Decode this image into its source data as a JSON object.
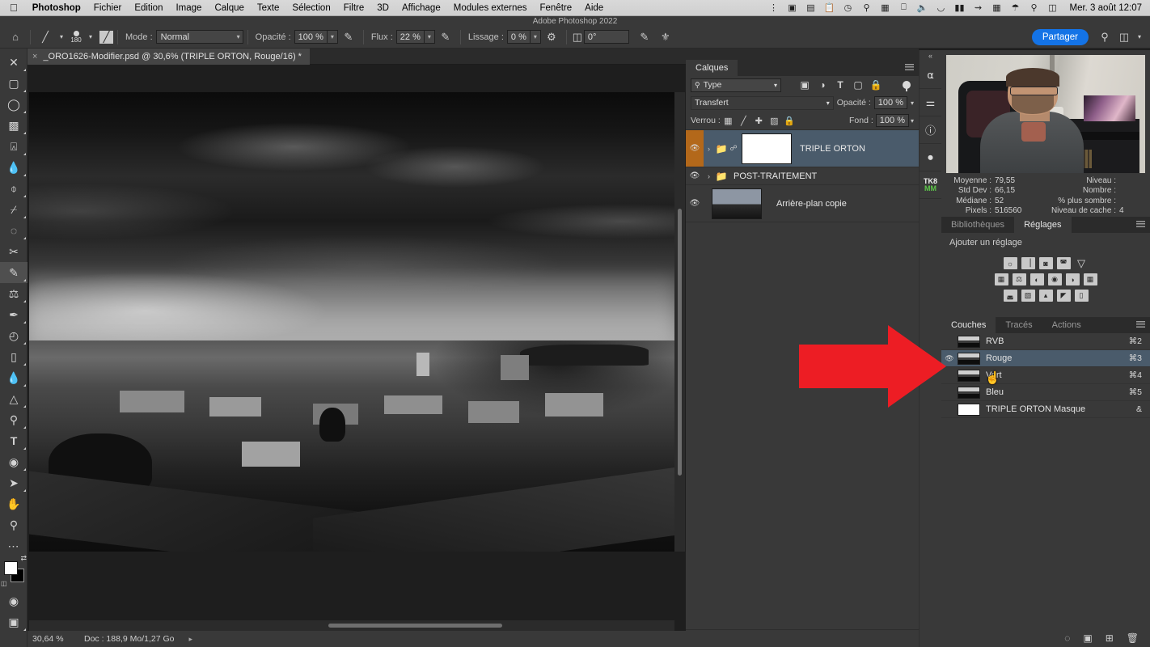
{
  "macbar": {
    "apple_icon": "apple-icon",
    "items": [
      {
        "label": "Photoshop",
        "bold": true
      },
      {
        "label": "Fichier",
        "bold": false
      },
      {
        "label": "Edition",
        "bold": false
      },
      {
        "label": "Image",
        "bold": false
      },
      {
        "label": "Calque",
        "bold": false
      },
      {
        "label": "Texte",
        "bold": false
      },
      {
        "label": "Sélection",
        "bold": false
      },
      {
        "label": "Filtre",
        "bold": false
      },
      {
        "label": "3D",
        "bold": false
      },
      {
        "label": "Affichage",
        "bold": false
      },
      {
        "label": "Modules externes",
        "bold": false
      },
      {
        "label": "Fenêtre",
        "bold": false
      },
      {
        "label": "Aide",
        "bold": false
      }
    ],
    "status_icons": [
      "dropbox-icon",
      "screen-record-icon",
      "display-icon",
      "clipboard-icon",
      "clock-icon",
      "binoculars-icon",
      "stats-icon",
      "monitor-icon",
      "volume-icon",
      "vpn-icon",
      "flag-belgium-icon",
      "bluetooth-icon",
      "battery-icon",
      "wifi-icon",
      "search-icon",
      "control-center-icon"
    ],
    "clock": "Mer. 3 août  12:07",
    "window_title": "Adobe Photoshop 2022"
  },
  "optionsbar": {
    "home_icon": "home-icon",
    "brush_preset_icon": "brush-preset-icon",
    "brush_size": "180",
    "brush_panel_icon": "brush-panel-icon",
    "mode_label": "Mode :",
    "mode_value": "Normal",
    "opacity_label": "Opacité :",
    "opacity_value": "100 %",
    "pressure_opacity_icon": "pressure-opacity-icon",
    "flow_label": "Flux :",
    "flow_value": "22 %",
    "airbrush_icon": "airbrush-icon",
    "smoothing_label": "Lissage :",
    "smoothing_value": "0 %",
    "smoothing_options_icon": "gear-icon",
    "angle_label": "angle-icon",
    "angle_value": "0°",
    "pressure_size_icon": "pressure-size-icon",
    "symmetry_icon": "symmetry-icon",
    "share_label": "Partager",
    "search_icon": "search-icon",
    "workspace_icon": "workspace-icon",
    "workspace_caret": "chevron-down-icon"
  },
  "document": {
    "close_icon": "close-icon",
    "tab_title": "_ORO1626-Modifier.psd @ 30,6% (TRIPLE ORTON, Rouge/16) *"
  },
  "tools": [
    {
      "name": "move-tool",
      "icon": "✛",
      "active": false,
      "corner": true
    },
    {
      "name": "rectangular-marquee-tool",
      "icon": "▭",
      "active": false,
      "corner": true
    },
    {
      "name": "lasso-tool",
      "icon": "◯",
      "active": false,
      "corner": true
    },
    {
      "name": "object-selection-tool",
      "icon": "◱",
      "active": false,
      "corner": true
    },
    {
      "name": "crop-tool",
      "icon": "⌗",
      "active": false,
      "corner": true
    },
    {
      "name": "eyedropper-tool",
      "icon": "✎",
      "active": false,
      "corner": true
    },
    {
      "name": "spot-healing-brush-tool",
      "icon": "✚",
      "active": false,
      "corner": true
    },
    {
      "name": "healing-brush-tool",
      "icon": "⊘",
      "active": false,
      "corner": true
    },
    {
      "name": "patch-tool",
      "icon": "◌",
      "active": false,
      "corner": true
    },
    {
      "name": "content-aware-move-tool",
      "icon": "✂",
      "active": false,
      "corner": false
    },
    {
      "name": "brush-tool",
      "icon": "✏",
      "active": true,
      "corner": true
    },
    {
      "name": "clone-stamp-tool",
      "icon": "⌶",
      "active": false,
      "corner": true
    },
    {
      "name": "history-brush-tool",
      "icon": "✒",
      "active": false,
      "corner": true
    },
    {
      "name": "eraser-tool",
      "icon": "◧",
      "active": false,
      "corner": true
    },
    {
      "name": "gradient-tool",
      "icon": "▤",
      "active": false,
      "corner": true
    },
    {
      "name": "blur-tool",
      "icon": "◐",
      "active": false,
      "corner": true
    },
    {
      "name": "dodge-tool",
      "icon": "▲",
      "active": false,
      "corner": true
    },
    {
      "name": "pen-tool",
      "icon": "✐",
      "active": false,
      "corner": true
    },
    {
      "name": "horizontal-type-tool",
      "icon": "T",
      "active": false,
      "corner": true
    },
    {
      "name": "path-selection-tool",
      "icon": "⬭",
      "active": false,
      "corner": true
    },
    {
      "name": "direct-selection-tool",
      "icon": "➤",
      "active": false,
      "corner": true
    },
    {
      "name": "hand-tool",
      "icon": "✋",
      "active": false,
      "corner": false
    },
    {
      "name": "zoom-tool",
      "icon": "⌕",
      "active": false,
      "corner": false
    },
    {
      "name": "edit-toolbar-button",
      "icon": "···",
      "active": false,
      "corner": false
    }
  ],
  "swatches": {
    "swap_icon": "swap-colors-icon",
    "default_icon": "default-colors-icon",
    "foreground": "#ffffff",
    "background": "#000000",
    "quickmask_icon": "quick-mask-icon",
    "screenmode_icon": "screen-mode-icon"
  },
  "status": {
    "zoom": "30,64 %",
    "doc": "Doc : 188,9 Mo/1,27 Go",
    "arrow": "chevron-right-icon"
  },
  "layers_panel": {
    "tab": "Calques",
    "menu_icon": "panel-menu-icon",
    "filter": {
      "search_icon": "search-icon",
      "type_value": "Type",
      "caret": "chevron-down-icon",
      "icons": [
        "pixel-filter-icon",
        "adjustment-filter-icon",
        "type-filter-icon",
        "shape-filter-icon",
        "smart-object-filter-icon"
      ],
      "toggle_icon": "filter-toggle-icon"
    },
    "blend_mode": "Transfert",
    "opacity_label": "Opacité :",
    "opacity_value": "100 %",
    "lock_label": "Verrou :",
    "lock_icons": [
      "lock-transparency-icon",
      "lock-image-icon",
      "lock-position-icon",
      "lock-artboard-icon",
      "lock-all-icon"
    ],
    "fill_label": "Fond :",
    "fill_value": "100 %",
    "layers": [
      {
        "name": "TRIPLE ORTON",
        "visible": true,
        "selected": true,
        "group": true,
        "expander": "›",
        "folder_icon": "folder-icon",
        "link_icon": "link-icon",
        "thumb": "mask",
        "eye_highlight": true
      },
      {
        "name": "POST-TRAITEMENT",
        "visible": true,
        "selected": false,
        "group": true,
        "expander": "›",
        "folder_icon": "folder-icon",
        "link_icon": "",
        "thumb": "none",
        "eye_highlight": false
      },
      {
        "name": "Arrière-plan copie",
        "visible": true,
        "selected": false,
        "group": false,
        "expander": "",
        "folder_icon": "",
        "link_icon": "",
        "thumb": "photo",
        "eye_highlight": false
      }
    ],
    "footer_icons": [
      "link-layers-icon",
      "layer-style-fx-icon",
      "add-mask-icon",
      "new-adjustment-layer-icon",
      "new-group-icon",
      "new-layer-icon",
      "delete-layer-icon"
    ]
  },
  "dock": {
    "collapse_icon": "collapse-panels-icon",
    "items": [
      {
        "name": "history-panel-icon",
        "glyph": "⁙"
      },
      {
        "name": "properties-panel-icon",
        "glyph": "⚌"
      },
      {
        "name": "info-panel-icon",
        "glyph": "ⓘ"
      },
      {
        "name": "actions-panel-icon",
        "glyph": "⌸"
      },
      {
        "name": "tk8-panel-icon",
        "glyph": "TK8"
      }
    ],
    "tk8_top": "TK8",
    "tk8_bottom": "MM"
  },
  "histogram_panel": {
    "webcam_label": "webcam-overlay",
    "stats": [
      {
        "label": "Moyenne :",
        "value": "79,55",
        "label2": "Niveau :",
        "value2": ""
      },
      {
        "label": "Std Dev :",
        "value": "66,15",
        "label2": "Nombre :",
        "value2": ""
      },
      {
        "label": "Médiane :",
        "value": "52",
        "label2": "% plus sombre :",
        "value2": ""
      },
      {
        "label": "Pixels :",
        "value": "516560",
        "label2": "Niveau de cache :",
        "value2": "4"
      }
    ]
  },
  "adjustments_panel": {
    "tabs": [
      {
        "label": "Bibliothèques",
        "active": false
      },
      {
        "label": "Réglages",
        "active": true
      }
    ],
    "menu_icon": "panel-menu-icon",
    "title": "Ajouter un réglage",
    "rows": [
      [
        {
          "name": "brightness-contrast-adjustment-icon",
          "glyph": "☼"
        },
        {
          "name": "levels-adjustment-icon",
          "glyph": "▥"
        },
        {
          "name": "curves-adjustment-icon",
          "glyph": "◩"
        },
        {
          "name": "exposure-adjustment-icon",
          "glyph": "◪"
        },
        {
          "name": "vibrance-adjustment-icon",
          "glyph": "▽"
        }
      ],
      [
        {
          "name": "hue-saturation-adjustment-icon",
          "glyph": "▦"
        },
        {
          "name": "color-balance-adjustment-icon",
          "glyph": "⚖"
        },
        {
          "name": "black-white-adjustment-icon",
          "glyph": "◧"
        },
        {
          "name": "photo-filter-adjustment-icon",
          "glyph": "◉"
        },
        {
          "name": "channel-mixer-adjustment-icon",
          "glyph": "◕"
        },
        {
          "name": "color-lookup-adjustment-icon",
          "glyph": "▩"
        }
      ],
      [
        {
          "name": "invert-adjustment-icon",
          "glyph": "◨"
        },
        {
          "name": "posterize-adjustment-icon",
          "glyph": "◫"
        },
        {
          "name": "threshold-adjustment-icon",
          "glyph": "◳"
        },
        {
          "name": "selective-color-adjustment-icon",
          "glyph": "◤"
        },
        {
          "name": "gradient-map-adjustment-icon",
          "glyph": "▤"
        }
      ]
    ]
  },
  "channels_panel": {
    "tabs": [
      {
        "label": "Couches",
        "active": true
      },
      {
        "label": "Tracés",
        "active": false
      },
      {
        "label": "Actions",
        "active": false
      }
    ],
    "menu_icon": "panel-menu-icon",
    "channels": [
      {
        "name": "RVB",
        "shortcut": "⌘2",
        "visible": false,
        "selected": false,
        "thumb": "rgb"
      },
      {
        "name": "Rouge",
        "shortcut": "⌘3",
        "visible": true,
        "selected": true,
        "thumb": "gray"
      },
      {
        "name": "Vert",
        "shortcut": "⌘4",
        "visible": false,
        "selected": false,
        "thumb": "gray"
      },
      {
        "name": "Bleu",
        "shortcut": "⌘5",
        "visible": false,
        "selected": false,
        "thumb": "gray"
      },
      {
        "name": "TRIPLE ORTON Masque",
        "shortcut": "&",
        "visible": false,
        "selected": false,
        "thumb": "white"
      }
    ],
    "footer_icons": [
      "load-channel-as-selection-icon",
      "save-selection-as-channel-icon",
      "new-channel-icon",
      "delete-channel-icon"
    ]
  },
  "annotation": {
    "arrow_name": "red-arrow-annotation",
    "arrow_color": "#ED1D24",
    "cursor_name": "pointing-hand-cursor"
  },
  "colors": {
    "panel_bg": "#393939",
    "panel_dark": "#2b2b2b",
    "selection_blue": "#4a5b6b",
    "accent_blue": "#1473e6",
    "eye_amber": "#b3681a"
  }
}
